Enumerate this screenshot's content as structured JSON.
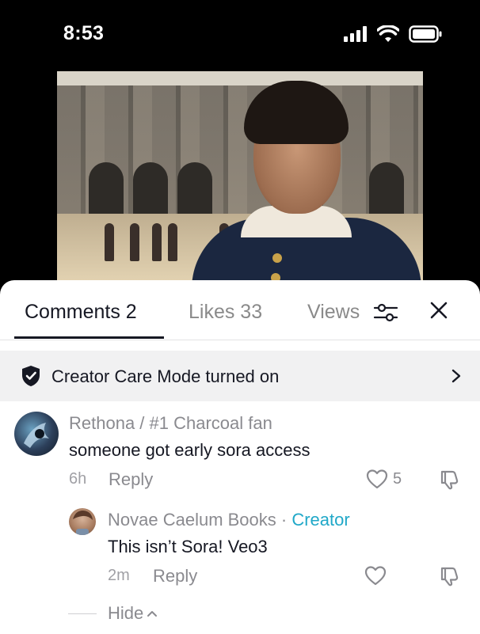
{
  "status_bar": {
    "time": "8:53",
    "icons": [
      "signal-icon",
      "wifi-icon",
      "battery-icon"
    ]
  },
  "video": {
    "icon": "video-frame"
  },
  "sheet": {
    "tabs": [
      {
        "label": "Comments 2",
        "active": true
      },
      {
        "label": "Likes 33",
        "active": false
      },
      {
        "label": "Views",
        "active": false
      }
    ],
    "filter_icon": "sliders-icon",
    "close_icon": "close-icon"
  },
  "care_banner": {
    "text": "Creator Care Mode turned on",
    "icon": "shield-check-icon",
    "chevron": "chevron-right-icon"
  },
  "comments": [
    {
      "author": "Rethona / #1 Charcoal fan",
      "text": "someone got early sora access",
      "time": "6h",
      "reply_label": "Reply",
      "likes": "5"
    }
  ],
  "replies": [
    {
      "author": "Novae Caelum Books",
      "separator": " · ",
      "badge": "Creator",
      "text": "This isn’t Sora! Veo3",
      "time": "2m",
      "reply_label": "Reply"
    }
  ],
  "hide_label": "Hide",
  "colors": {
    "creator_badge": "#20a8c8",
    "text_primary": "#161823",
    "text_secondary": "#8a8a8f",
    "banner_bg": "#f1f1f2"
  }
}
